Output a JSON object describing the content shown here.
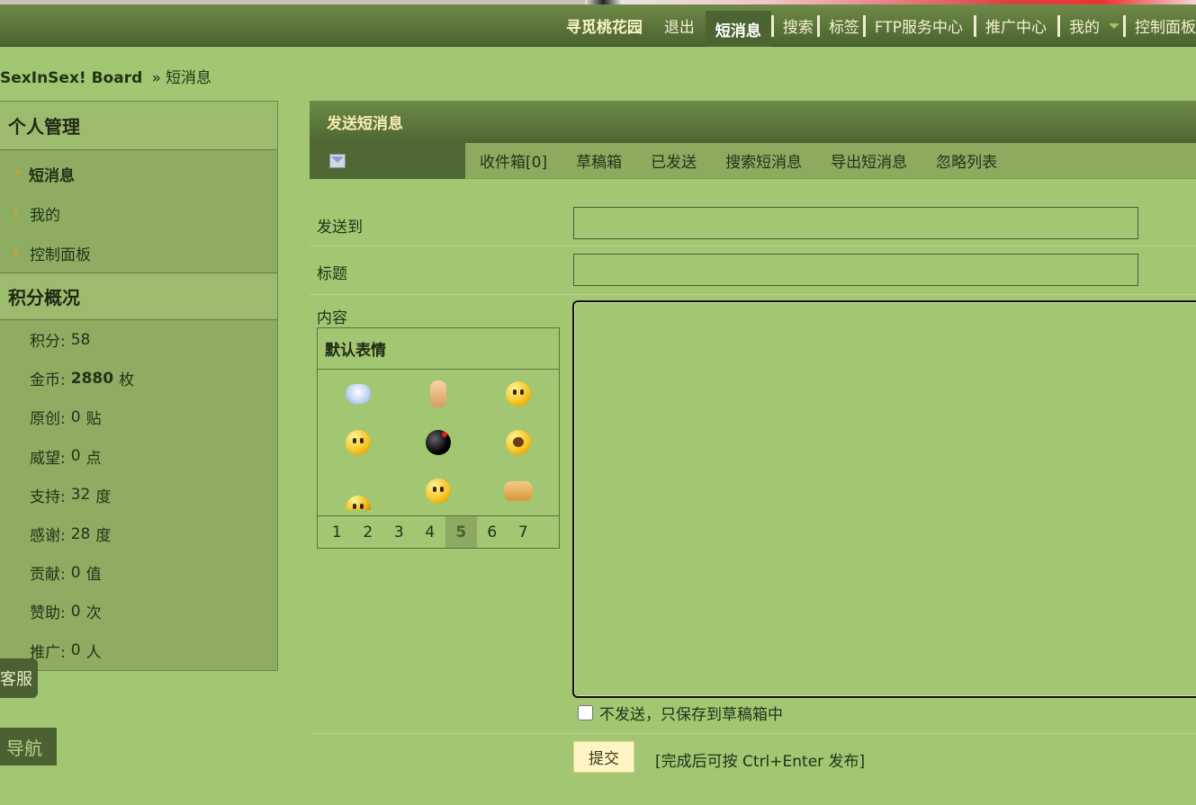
{
  "topnav": {
    "brand": "寻觅桃花园",
    "logout": "退出",
    "messages": "短消息",
    "search": "搜索",
    "tags": "标签",
    "ftp": "FTP服务中心",
    "promo": "推广中心",
    "mine": "我的",
    "control_panel": "控制面板"
  },
  "breadcrumb": {
    "board": "SexInSex! Board",
    "separator": "»",
    "current": "短消息"
  },
  "sidebar": {
    "personal_title": "个人管理",
    "items": [
      {
        "label": "短消息"
      },
      {
        "label": "我的"
      },
      {
        "label": "控制面板"
      }
    ],
    "credits_title": "积分概况",
    "credits": [
      {
        "label": "积分:",
        "value": "58",
        "unit": ""
      },
      {
        "label": "金币:",
        "value": "2880",
        "unit": "枚"
      },
      {
        "label": "原创:",
        "value": "0",
        "unit": "贴"
      },
      {
        "label": "威望:",
        "value": "0",
        "unit": "点"
      },
      {
        "label": "支持:",
        "value": "32",
        "unit": "度"
      },
      {
        "label": "感谢:",
        "value": "28",
        "unit": "度"
      },
      {
        "label": "贡献:",
        "value": "0",
        "unit": "值"
      },
      {
        "label": "赞助:",
        "value": "0",
        "unit": "次"
      },
      {
        "label": "推广:",
        "value": "0",
        "unit": "人"
      }
    ]
  },
  "floating": {
    "kefu": "客服",
    "nav": "导航"
  },
  "main": {
    "title": "发送短消息",
    "tabs": [
      "收件箱[0]",
      "草稿箱",
      "已发送",
      "搜索短消息",
      "导出短消息",
      "忽略列表"
    ],
    "to_label": "发送到",
    "to_value": "",
    "subject_label": "标题",
    "subject_value": "",
    "content_label": "内容",
    "smilies_title": "默认表情",
    "pages": [
      "1",
      "2",
      "3",
      "4",
      "5",
      "6",
      "7"
    ],
    "current_page": "5",
    "draft_label": "不发送，只保存到草稿箱中",
    "submit_label": "提交",
    "hint": "[完成后可按 Ctrl+Enter 发布]"
  }
}
